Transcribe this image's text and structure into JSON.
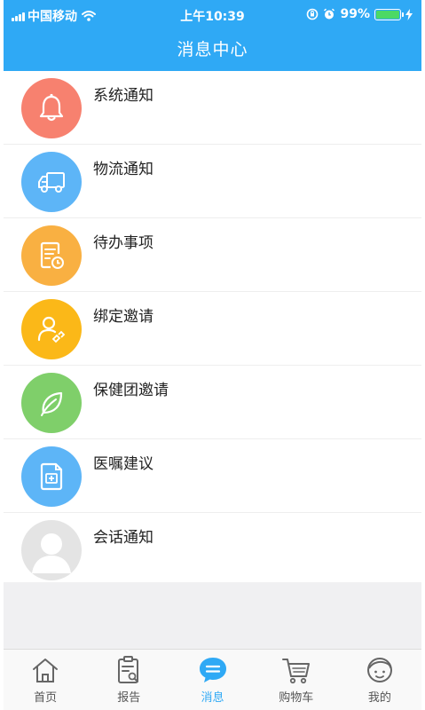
{
  "status_bar": {
    "carrier": "中国移动",
    "time": "上午10:39",
    "battery": "99%",
    "battery_level": 0.99
  },
  "header": {
    "title": "消息中心"
  },
  "messages": [
    {
      "label": "系统通知",
      "icon": "bell-icon",
      "color": "#f7816f"
    },
    {
      "label": "物流通知",
      "icon": "truck-icon",
      "color": "#5db5f7"
    },
    {
      "label": "待办事项",
      "icon": "todo-icon",
      "color": "#f9b042"
    },
    {
      "label": "绑定邀请",
      "icon": "bind-user-icon",
      "color": "#fbb818"
    },
    {
      "label": "保健团邀请",
      "icon": "leaf-icon",
      "color": "#7fcf6a"
    },
    {
      "label": "医嘱建议",
      "icon": "prescription-icon",
      "color": "#5db5f7"
    },
    {
      "label": "会话通知",
      "icon": "avatar-icon",
      "color": "#e4e4e4"
    }
  ],
  "tabbar": {
    "active": "消息",
    "items": [
      {
        "label": "首页",
        "icon": "home-icon"
      },
      {
        "label": "报告",
        "icon": "report-icon"
      },
      {
        "label": "消息",
        "icon": "message-icon"
      },
      {
        "label": "购物车",
        "icon": "cart-icon"
      },
      {
        "label": "我的",
        "icon": "profile-icon"
      }
    ]
  },
  "colors": {
    "accent": "#2fa9f5",
    "background_gray": "#f0f0f2"
  }
}
